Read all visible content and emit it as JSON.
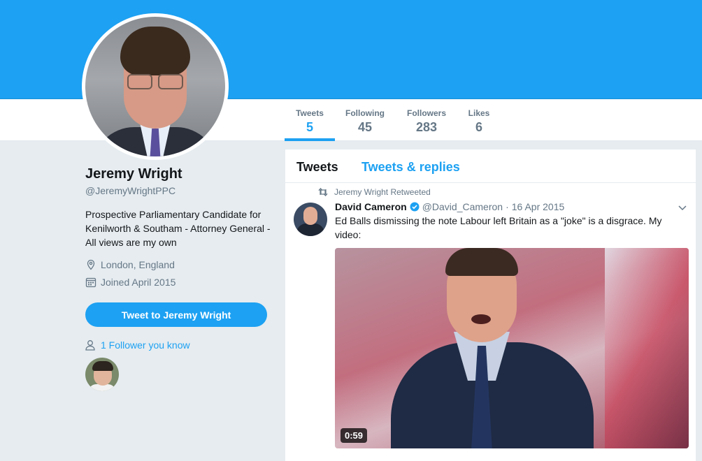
{
  "profile": {
    "name": "Jeremy Wright",
    "handle": "@JeremyWrightPPC",
    "bio": "Prospective Parliamentary Candidate for Kenilworth & Southam - Attorney General - All views are my own",
    "location": "London, England",
    "joined": "Joined April 2015",
    "tweet_to_label": "Tweet to Jeremy Wright",
    "followers_you_know": "1 Follower you know"
  },
  "nav": {
    "items": [
      {
        "label": "Tweets",
        "value": "5"
      },
      {
        "label": "Following",
        "value": "45"
      },
      {
        "label": "Followers",
        "value": "283"
      },
      {
        "label": "Likes",
        "value": "6"
      }
    ]
  },
  "timeline": {
    "tabs": [
      "Tweets",
      "Tweets & replies"
    ],
    "tweet": {
      "context": "Jeremy Wright Retweeted",
      "author_name": "David Cameron",
      "author_handle": "@David_Cameron",
      "dot": "·",
      "date": "16 Apr 2015",
      "text": "Ed Balls dismissing the note Labour left Britain as a \"joke\" is a disgrace. My video:",
      "video_duration": "0:59"
    }
  },
  "colors": {
    "accent": "#1da1f2",
    "secondary_text": "#657786",
    "primary_text": "#14171a",
    "background": "#e6ecf0"
  },
  "icons": [
    "location-icon",
    "calendar-icon",
    "person-icon",
    "retweet-icon",
    "verified-icon",
    "chevron-down-icon"
  ]
}
